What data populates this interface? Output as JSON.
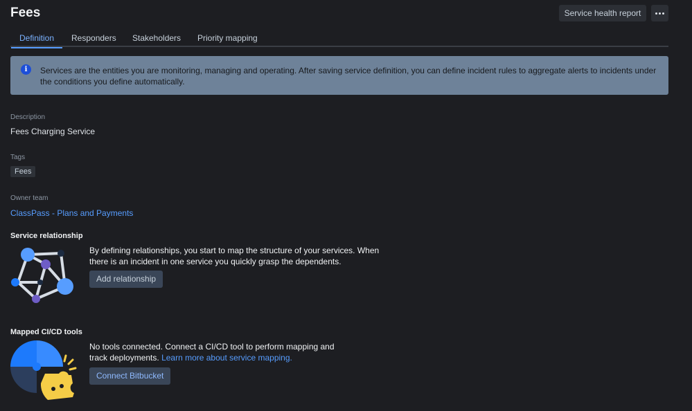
{
  "header": {
    "title": "Fees",
    "health_report_label": "Service health report",
    "more_icon": "more-horizontal-icon"
  },
  "tabs": [
    {
      "label": "Definition",
      "active": true
    },
    {
      "label": "Responders",
      "active": false
    },
    {
      "label": "Stakeholders",
      "active": false
    },
    {
      "label": "Priority mapping",
      "active": false
    }
  ],
  "info_banner": {
    "icon": "info-icon",
    "text": "Services are the entities you are monitoring, managing and operating. After saving service definition, you can define incident rules to aggregate alerts to incidents under the conditions you define automatically."
  },
  "description": {
    "label": "Description",
    "value": "Fees Charging Service"
  },
  "tags": {
    "label": "Tags",
    "items": [
      "Fees"
    ]
  },
  "owner_team": {
    "label": "Owner team",
    "value": "ClassPass - Plans and Payments"
  },
  "service_relationship": {
    "title": "Service relationship",
    "text": "By defining relationships, you start to map the structure of your services. When there is an incident in one service you quickly grasp the dependents.",
    "button_label": "Add relationship",
    "illustration": "service-graph-illustration"
  },
  "cicd": {
    "title": "Mapped CI/CD tools",
    "text": "No tools connected. Connect a CI/CD tool to perform mapping and track deployments.",
    "link_text": "Learn more about service mapping.",
    "button_label": "Connect Bitbucket",
    "illustration": "puzzle-illustration"
  },
  "colors": {
    "background": "#1d1e22",
    "accent": "#579dff",
    "banner": "#6e8299",
    "button": "#2c2f35"
  }
}
